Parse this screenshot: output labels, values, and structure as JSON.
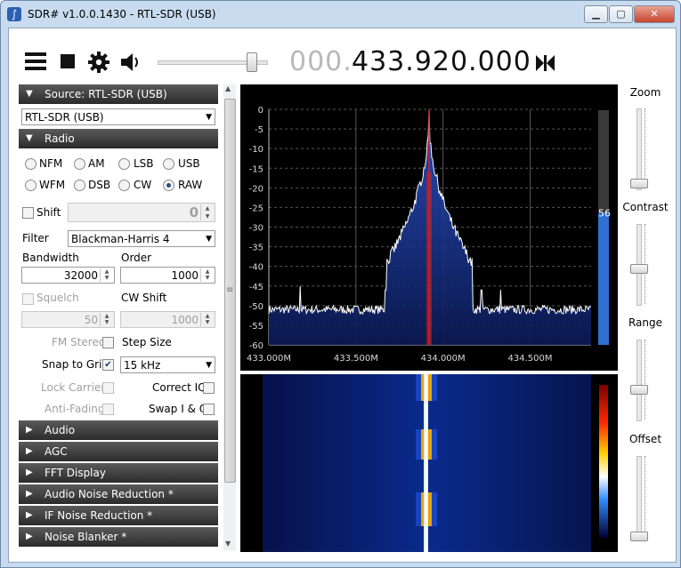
{
  "window": {
    "title": "SDR# v1.0.0.1430 - RTL-SDR (USB)"
  },
  "toolbar": {
    "freq_prefix": "000.",
    "freq_main": "433.920.000"
  },
  "source": {
    "header": "Source: RTL-SDR (USB)",
    "device": "RTL-SDR (USB)"
  },
  "radio": {
    "header": "Radio",
    "modes_row1": [
      "NFM",
      "AM",
      "LSB",
      "USB"
    ],
    "modes_row2": [
      "WFM",
      "DSB",
      "CW",
      "RAW"
    ],
    "selected_mode": "RAW",
    "shift_label": "Shift",
    "shift_value": "0",
    "filter_label": "Filter",
    "filter_value": "Blackman-Harris 4",
    "bandwidth_label": "Bandwidth",
    "bandwidth_value": "32000",
    "order_label": "Order",
    "order_value": "1000",
    "squelch_label": "Squelch",
    "squelch_value": "50",
    "cwshift_label": "CW Shift",
    "cwshift_value": "1000",
    "fmstereo_label": "FM Stereo",
    "stepsize_label": "Step Size",
    "snap_label": "Snap to Grid",
    "snap_checked": true,
    "step_value": "15 kHz",
    "lockcarrier_label": "Lock Carrier",
    "correctiq_label": "Correct IQ",
    "antifading_label": "Anti-Fading",
    "swapiq_label": "Swap I & Q"
  },
  "sections": [
    "Audio",
    "AGC",
    "FFT Display",
    "Audio Noise Reduction *",
    "IF Noise Reduction *",
    "Noise Blanker *"
  ],
  "right": {
    "zoom": "Zoom",
    "contrast": "Contrast",
    "range": "Range",
    "offset": "Offset",
    "level_value": "56"
  },
  "colors": {
    "accent": "#2f6fd1",
    "peak_red": "#d02020"
  },
  "chart_data": {
    "type": "line",
    "title": "",
    "xlabel": "",
    "ylabel": "",
    "ylim": [
      -60,
      0
    ],
    "xlim_mhz": [
      433.0,
      434.85
    ],
    "yticks": [
      "0",
      "-5",
      "-10",
      "-15",
      "-20",
      "-25",
      "-30",
      "-35",
      "-40",
      "-45",
      "-50",
      "-55",
      "-60"
    ],
    "xticks": [
      "433.000M",
      "433.500M",
      "434.000M",
      "434.500M"
    ],
    "center_mhz": 433.92,
    "noise_floor_db": -51,
    "peak_db": 0,
    "spurs": [
      {
        "x": 433.18,
        "y": -45
      },
      {
        "x": 433.67,
        "y": -46
      },
      {
        "x": 434.22,
        "y": -46
      },
      {
        "x": 434.33,
        "y": -46
      }
    ]
  }
}
